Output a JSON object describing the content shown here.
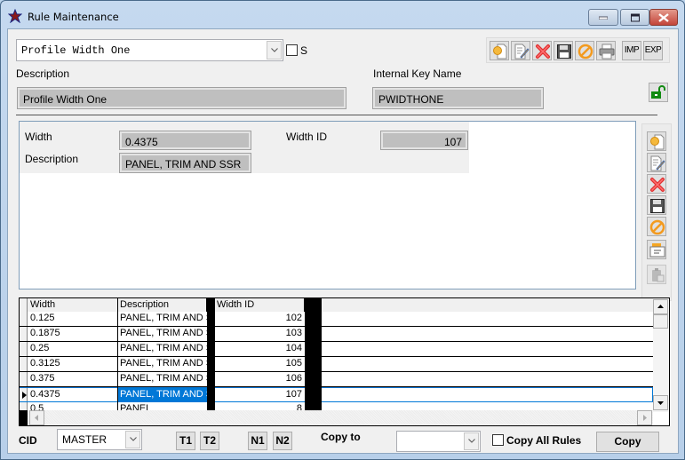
{
  "window": {
    "title": "Rule Maintenance",
    "controls": {
      "minimize": "minimize",
      "maximize": "maximize",
      "close": "close"
    }
  },
  "rule_selector": {
    "value": "Profile Width One",
    "s_checkbox_label": "S",
    "s_checked": false
  },
  "description": {
    "label": "Description",
    "value": "Profile Width One"
  },
  "internal_key": {
    "label": "Internal Key Name",
    "value": "PWIDTHONE"
  },
  "toolbar": {
    "items": [
      {
        "name": "new",
        "icon": "new-document-icon"
      },
      {
        "name": "edit",
        "icon": "edit-document-icon"
      },
      {
        "name": "delete",
        "icon": "delete-x-icon"
      },
      {
        "name": "save",
        "icon": "save-disk-icon"
      },
      {
        "name": "cancel",
        "icon": "cancel-circle-icon"
      },
      {
        "name": "print",
        "icon": "printer-icon"
      },
      {
        "name": "import",
        "label": "IMP"
      },
      {
        "name": "export",
        "label": "EXP"
      }
    ],
    "lock_icon": "unlocked-padlock-icon"
  },
  "detail": {
    "width_label": "Width",
    "width_value": "0.4375",
    "description_label": "Description",
    "description_value": "PANEL, TRIM AND SSR",
    "width_id_label": "Width ID",
    "width_id_value": "107"
  },
  "side_toolbar": {
    "items": [
      "new-document-icon",
      "edit-document-icon",
      "delete-x-icon",
      "save-disk-icon",
      "cancel-circle-icon",
      "copy-record-icon",
      "paste-record-icon"
    ]
  },
  "grid": {
    "columns": [
      "Width",
      "Description",
      "Width ID"
    ],
    "rows": [
      {
        "width": "0.125",
        "description": "PANEL, TRIM AND S",
        "width_id": "102"
      },
      {
        "width": "0.1875",
        "description": "PANEL, TRIM AND S",
        "width_id": "103"
      },
      {
        "width": "0.25",
        "description": "PANEL, TRIM AND S",
        "width_id": "104"
      },
      {
        "width": "0.3125",
        "description": "PANEL, TRIM AND S",
        "width_id": "105"
      },
      {
        "width": "0.375",
        "description": "PANEL, TRIM AND S",
        "width_id": "106"
      },
      {
        "width": "0.4375",
        "description": "PANEL, TRIM AND S",
        "width_id": "107"
      },
      {
        "width": "0.5",
        "description": "PANEL",
        "width_id": "8"
      }
    ],
    "selected_row": 5
  },
  "footer": {
    "cid_label": "CID",
    "cid_value": "MASTER",
    "t1": "T1",
    "t2": "T2",
    "n1": "N1",
    "n2": "N2",
    "copy_to_label": "Copy to",
    "copy_to_value": "",
    "copy_all_rules_label": "Copy All Rules",
    "copy_all_checked": false,
    "copy_button": "Copy"
  },
  "colors": {
    "selection": "#0078d7",
    "field_bg": "#bfbfbf",
    "window_frame": "#bcd4ec",
    "close_button": "#c3453a"
  }
}
